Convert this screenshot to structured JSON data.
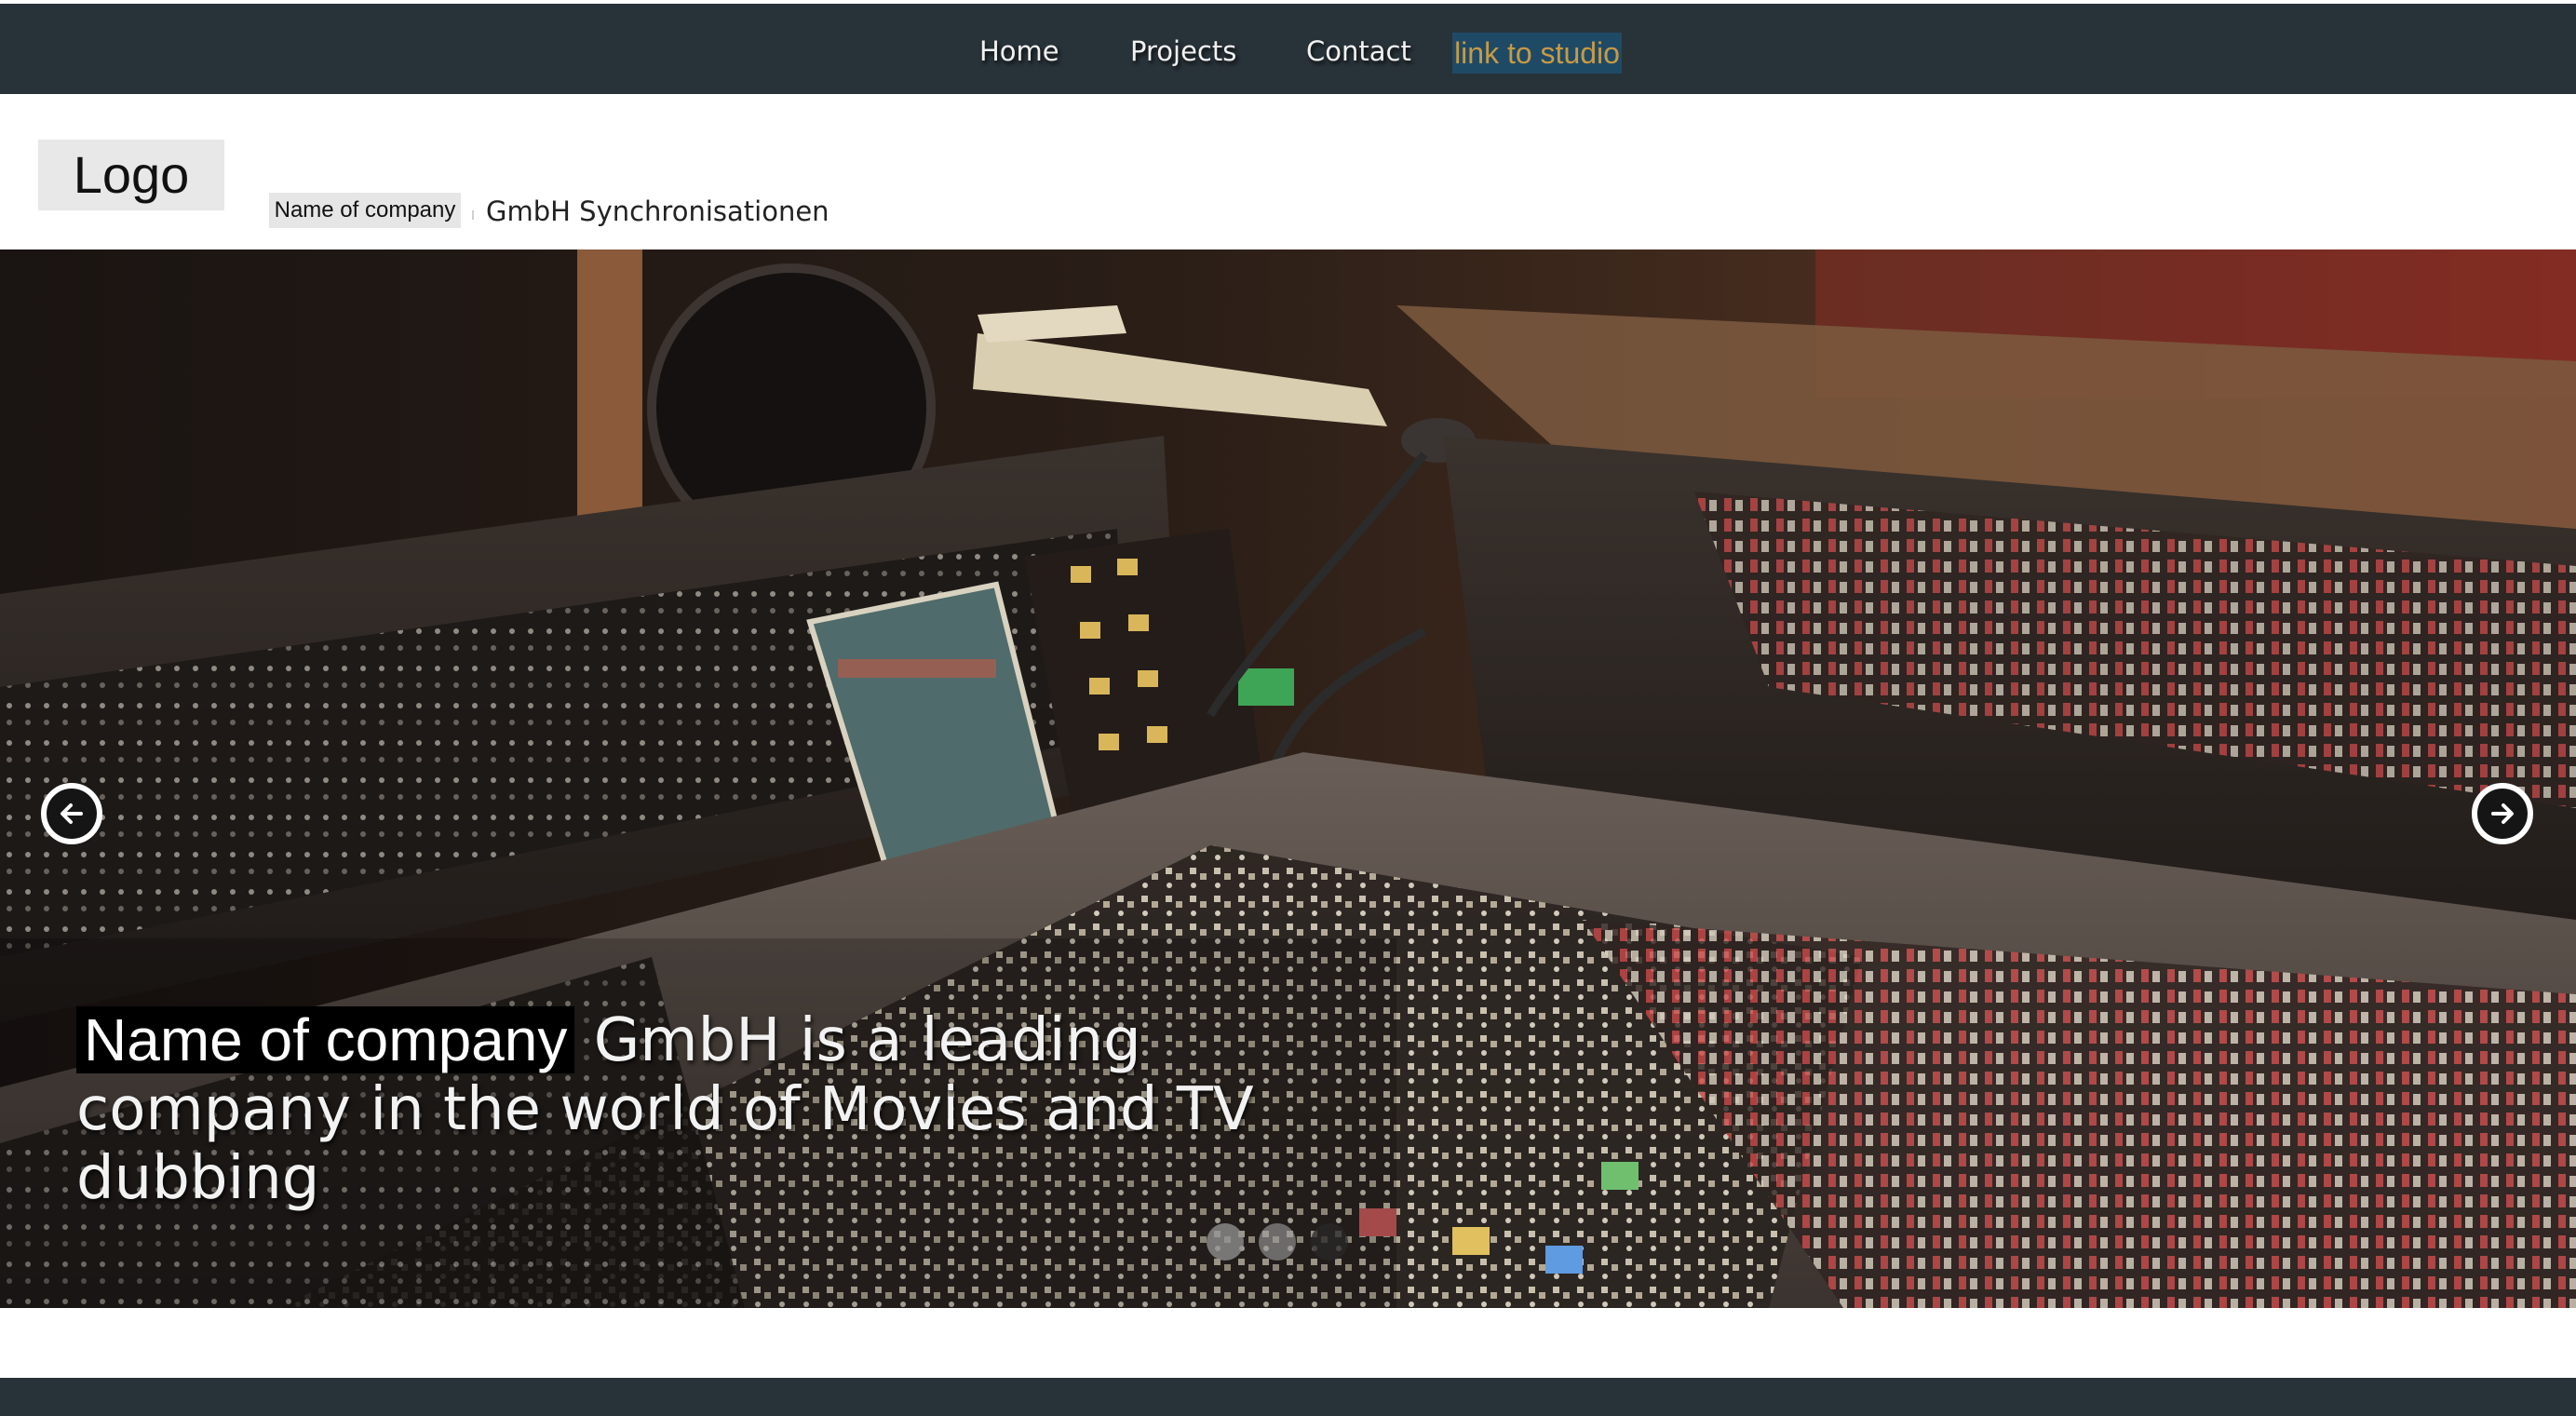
{
  "nav": {
    "items": [
      {
        "label": "Home"
      },
      {
        "label": "Projects"
      },
      {
        "label": "Contact"
      }
    ],
    "studio_link": "link to studio"
  },
  "header": {
    "logo": "Logo",
    "company_name": "Name of company",
    "company_suffix": "GmbH Synchronisationen"
  },
  "hero": {
    "caption_highlight": "Name of company",
    "caption_rest": " GmbH is a leading company in the world of Movies and TV dubbing",
    "slides_total": 3,
    "active_slide": 1,
    "icons": {
      "prev": "arrow-left-circle-icon",
      "next": "arrow-right-circle-icon"
    }
  },
  "colors": {
    "topbar": "#283239",
    "studio_link_bg": "#1f4a66",
    "studio_link_text": "#c79a45",
    "footer": "#283239"
  }
}
